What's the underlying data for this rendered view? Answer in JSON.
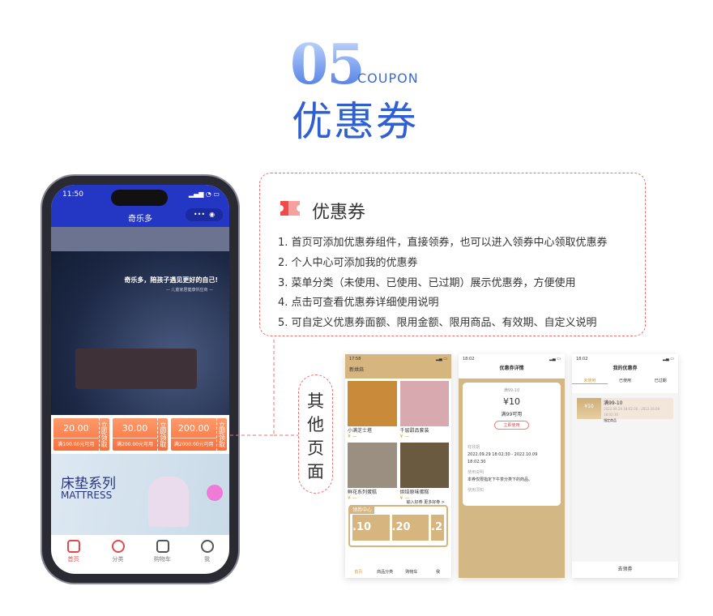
{
  "header": {
    "number": "05",
    "en": "COUPON",
    "title": "优惠券"
  },
  "phone": {
    "time": "11:50",
    "app_title": "奇乐多",
    "banner_slogan": "奇乐多，陪孩子遇见更好的自己!",
    "banner_sub": "— 儿童家居健康供应商 —",
    "coupons": [
      {
        "amount": "20.00",
        "cond": "满100.00元可用",
        "action": "立即领取"
      },
      {
        "amount": "30.00",
        "cond": "满200.00元可用",
        "action": "立即领取"
      },
      {
        "amount": "200.00",
        "cond": "满2000.00元可用",
        "action": "立即领取"
      }
    ],
    "mattress": {
      "cn": "床垫系列",
      "en": "MATTRESS"
    },
    "tabs": [
      {
        "label": "首页",
        "active": true
      },
      {
        "label": "分类"
      },
      {
        "label": "购物车"
      },
      {
        "label": "我"
      }
    ],
    "accent": "#2436c4"
  },
  "feature": {
    "title": "优惠券",
    "items": [
      "1. 首页可添加优惠券组件，直接领券，也可以进入领券中心领取优惠券",
      "2. 个人中心可添加我的优惠券",
      "3. 菜单分类（未使用、已使用、已过期）展示优惠券，方便使用",
      "4. 点击可查看优惠券详细使用说明",
      "5. 可自定义优惠券面额、限用金额、限用商品、有效期、自定义说明"
    ]
  },
  "other_pages": "其他页面",
  "screens": {
    "home": {
      "time": "17:58",
      "title": "新烘焙",
      "products": [
        "小满芝士塔",
        "千层甜品套装",
        "鲜花系列蛋糕",
        "烘焙原味蛋糕"
      ],
      "coupon_center": "领券中心",
      "coupon_link": "输入好券 更多好券 >",
      "coupons": [
        ".10",
        ".20",
        ".2"
      ],
      "tabs": [
        "首页",
        "商品分类",
        "购物车",
        "我"
      ]
    },
    "detail": {
      "time": "18:02",
      "title": "优惠券详情",
      "name": "满99-10",
      "amount": "¥10",
      "cond": "满99可用",
      "button": "立即使用",
      "valid_label": "有效期",
      "valid": "2022.09.29 18:02:30 - 2022.10.09 18:02:30",
      "scope_label": "使用说明",
      "scope": "本券仅限指定下午茶分类下的商品。",
      "note_label": "使用须知"
    },
    "mine": {
      "time": "18:02",
      "title": "我的优惠券",
      "tabs": [
        "未使用",
        "已使用",
        "已过期"
      ],
      "coupon_amount": "¥10",
      "coupon_name": "满99-10",
      "coupon_valid": "2022.09.29 18:02:30 - 2022.10.09 18:02:30",
      "coupon_scope": "指定商品",
      "button": "去领券"
    }
  }
}
